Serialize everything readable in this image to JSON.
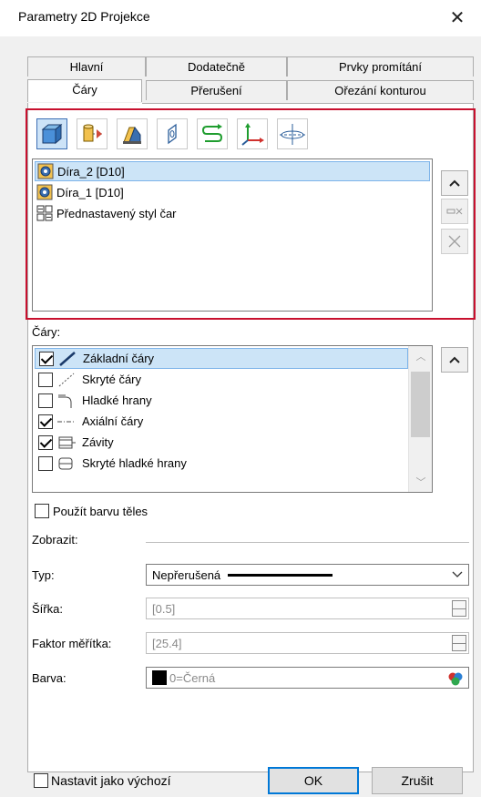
{
  "window": {
    "title": "Parametry 2D Projekce",
    "close_icon": "close-icon"
  },
  "tabs": {
    "row1": [
      "Hlavní",
      "Dodatečně",
      "Prvky promítání"
    ],
    "row2": [
      "Čáry",
      "Přerušení",
      "Ořezání konturou"
    ],
    "active": "Čáry"
  },
  "toolbar": {
    "icons": [
      "solid-cube-icon",
      "projection-cylinder-icon",
      "section-bracket-icon",
      "flat-hole-icon",
      "sweep-path-icon",
      "axis-arrows-icon",
      "center-line-icon"
    ]
  },
  "styles_list": {
    "items": [
      {
        "label": "Díra_2 [D10]",
        "icon": "hole-feature-icon",
        "selected": true
      },
      {
        "label": "Díra_1 [D10]",
        "icon": "hole-feature-icon",
        "selected": false
      },
      {
        "label": "Přednastavený styl čar",
        "icon": "line-style-grid-icon",
        "selected": false
      }
    ],
    "side_buttons": [
      "chevron-up-icon",
      "remove-item-icon",
      "close-icon"
    ]
  },
  "lines": {
    "label": "Čáry:",
    "items": [
      {
        "label": "Základní čáry",
        "checked": true,
        "selected": true
      },
      {
        "label": "Skryté čáry",
        "checked": false,
        "selected": false
      },
      {
        "label": "Hladké hrany",
        "checked": false,
        "selected": false
      },
      {
        "label": "Axiální čáry",
        "checked": true,
        "selected": false
      },
      {
        "label": "Závity",
        "checked": true,
        "selected": false
      },
      {
        "label": "Skryté hladké hrany",
        "checked": false,
        "selected": false
      }
    ]
  },
  "use_body_color": {
    "label": "Použít barvu těles",
    "checked": false
  },
  "display": {
    "label": "Zobrazit:",
    "type_label": "Typ:",
    "type_value": "Nepřerušená",
    "width_label": "Šířka:",
    "width_value": "[0.5]",
    "scale_label": "Faktor měřítka:",
    "scale_value": "[25.4]",
    "color_label": "Barva:",
    "color_value": "0=Černá",
    "color_swatch": "#000000"
  },
  "footer": {
    "default_label": "Nastavit jako výchozí",
    "ok_label": "OK",
    "cancel_label": "Zrušit"
  }
}
